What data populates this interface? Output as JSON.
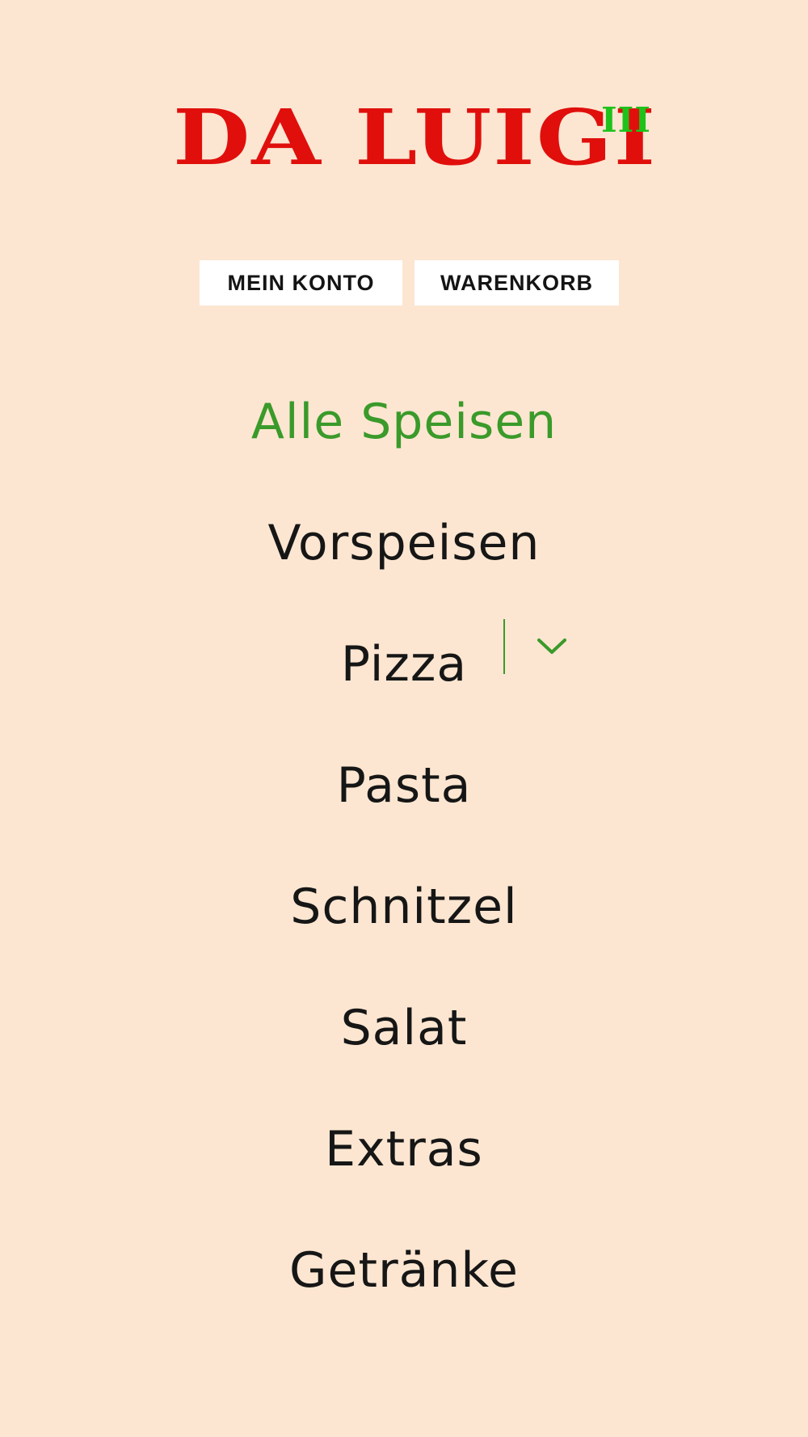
{
  "header": {
    "logo_text": "DA LUIGI",
    "logo_superscript": "III",
    "account_button_label": "MEIN KONTO",
    "cart_button_label": "WARENKORB"
  },
  "menu": {
    "items": [
      {
        "label": "Alle Speisen",
        "active": true
      },
      {
        "label": "Vorspeisen"
      },
      {
        "label": "Pizza",
        "has_submenu": true
      },
      {
        "label": "Pasta"
      },
      {
        "label": "Schnitzel"
      },
      {
        "label": "Salat"
      },
      {
        "label": "Extras"
      },
      {
        "label": "Getränke"
      }
    ],
    "submenu_icon": "chevron-down-icon"
  },
  "colors": {
    "background": "#fce6d1",
    "logo_red": "#e00f0c",
    "logo_green": "#1fc21a",
    "active_green": "#3a9a2a",
    "text": "#161616"
  }
}
